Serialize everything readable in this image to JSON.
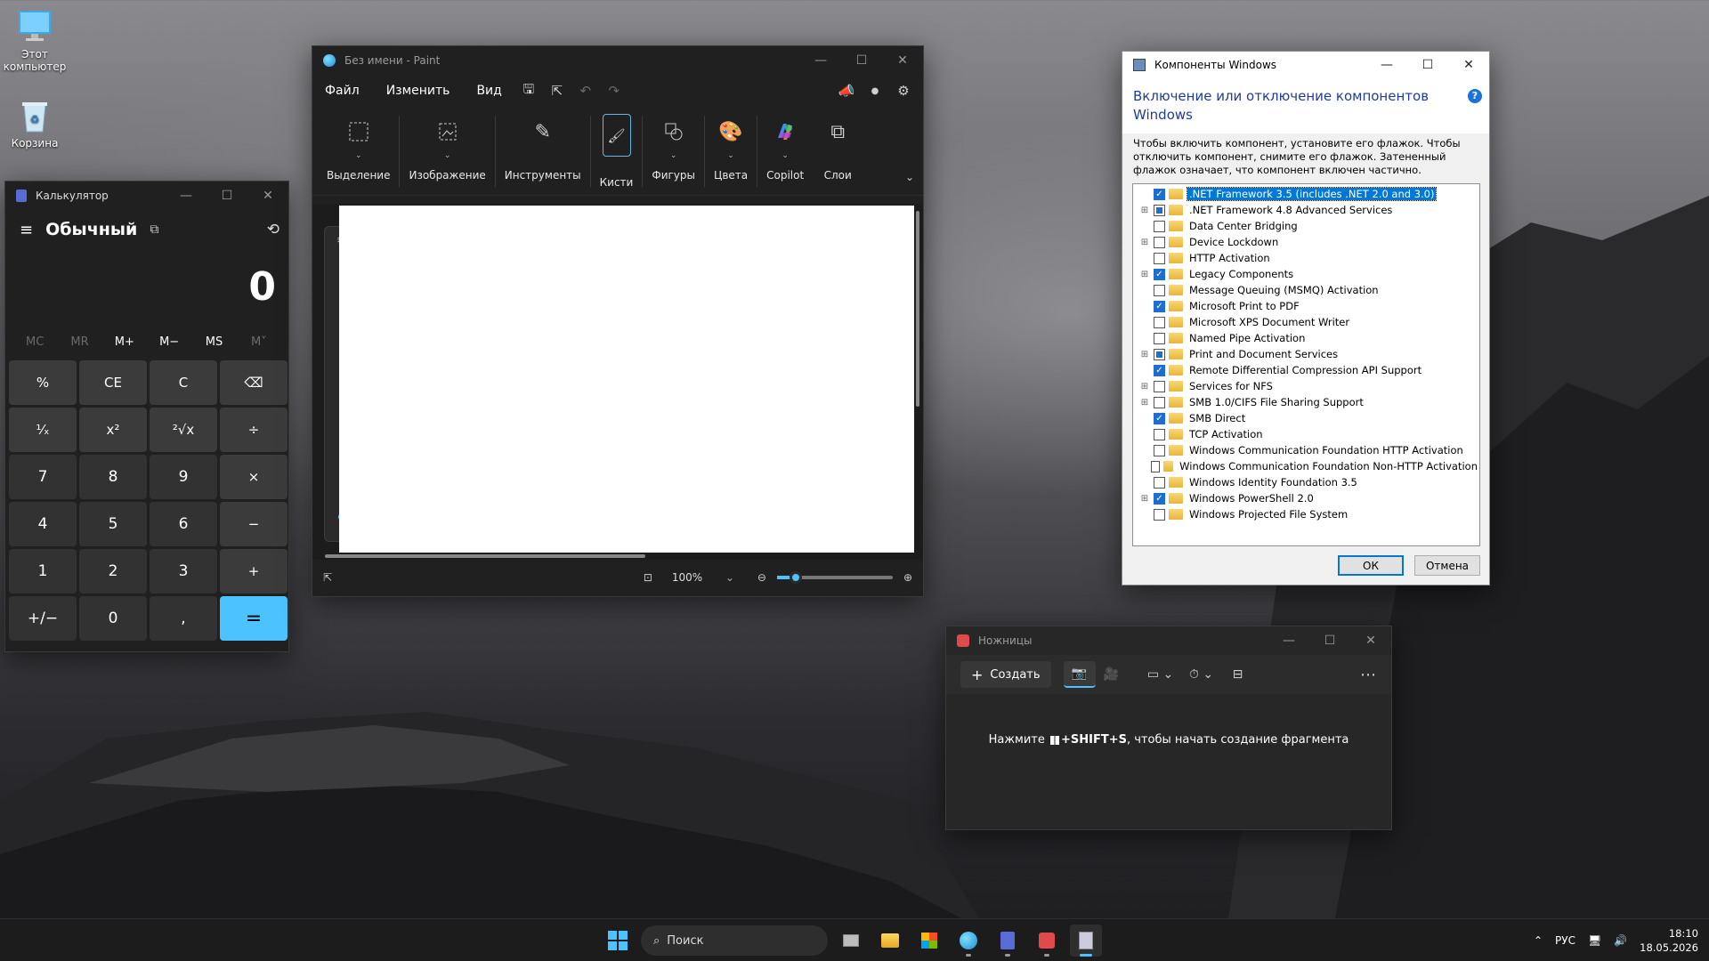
{
  "desktop": {
    "icons": [
      {
        "label": "Этот компьютер"
      },
      {
        "label": "Корзина"
      }
    ]
  },
  "calculator": {
    "title": "Калькулятор",
    "mode": "Обычный",
    "display": "0",
    "memory": [
      "MC",
      "MR",
      "M+",
      "M−",
      "MS",
      "M˅"
    ],
    "keys": [
      "%",
      "CE",
      "C",
      "⌫",
      "¹⁄ₓ",
      "x²",
      "²√x",
      "÷",
      "7",
      "8",
      "9",
      "×",
      "4",
      "5",
      "6",
      "−",
      "1",
      "2",
      "3",
      "+",
      "+/−",
      "0",
      ",",
      "="
    ]
  },
  "paint": {
    "title": "Без имени - Paint",
    "menu": [
      "Файл",
      "Изменить",
      "Вид"
    ],
    "ribbon": [
      "Выделение",
      "Изображение",
      "Инструменты",
      "Кисти",
      "Фигуры",
      "Цвета",
      "Copilot",
      "Слои"
    ],
    "zoom": "100%"
  },
  "features": {
    "title": "Компоненты Windows",
    "heading": "Включение или отключение компонентов Windows",
    "description": "Чтобы включить компонент, установите его флажок. Чтобы отключить компонент, снимите его флажок. Затененный флажок означает, что компонент включен частично.",
    "items": [
      {
        "label": ".NET Framework 3.5 (includes .NET 2.0 and 3.0)",
        "state": "on",
        "expand": false,
        "selected": true
      },
      {
        "label": ".NET Framework 4.8 Advanced Services",
        "state": "part",
        "expand": true,
        "selected": false
      },
      {
        "label": "Data Center Bridging",
        "state": "off",
        "expand": false,
        "selected": false
      },
      {
        "label": "Device Lockdown",
        "state": "off",
        "expand": true,
        "selected": false
      },
      {
        "label": "HTTP Activation",
        "state": "off",
        "expand": false,
        "selected": false
      },
      {
        "label": "Legacy Components",
        "state": "on",
        "expand": true,
        "selected": false
      },
      {
        "label": "Message Queuing (MSMQ) Activation",
        "state": "off",
        "expand": false,
        "selected": false
      },
      {
        "label": "Microsoft Print to PDF",
        "state": "on",
        "expand": false,
        "selected": false
      },
      {
        "label": "Microsoft XPS Document Writer",
        "state": "off",
        "expand": false,
        "selected": false
      },
      {
        "label": "Named Pipe Activation",
        "state": "off",
        "expand": false,
        "selected": false
      },
      {
        "label": "Print and Document Services",
        "state": "part",
        "expand": true,
        "selected": false
      },
      {
        "label": "Remote Differential Compression API Support",
        "state": "on",
        "expand": false,
        "selected": false
      },
      {
        "label": "Services for NFS",
        "state": "off",
        "expand": true,
        "selected": false
      },
      {
        "label": "SMB 1.0/CIFS File Sharing Support",
        "state": "off",
        "expand": true,
        "selected": false
      },
      {
        "label": "SMB Direct",
        "state": "on",
        "expand": false,
        "selected": false
      },
      {
        "label": "TCP Activation",
        "state": "off",
        "expand": false,
        "selected": false
      },
      {
        "label": "Windows Communication Foundation HTTP Activation",
        "state": "off",
        "expand": false,
        "selected": false
      },
      {
        "label": "Windows Communication Foundation Non-HTTP Activation",
        "state": "off",
        "expand": false,
        "selected": false
      },
      {
        "label": "Windows Identity Foundation 3.5",
        "state": "off",
        "expand": false,
        "selected": false
      },
      {
        "label": "Windows PowerShell 2.0",
        "state": "on",
        "expand": true,
        "selected": false
      },
      {
        "label": "Windows Projected File System",
        "state": "off",
        "expand": false,
        "selected": false
      }
    ],
    "ok_label": "ОК",
    "cancel_label": "Отмена"
  },
  "snipping": {
    "title": "Ножницы",
    "create_label": "Создать",
    "message_prefix": "Нажмите",
    "message_keys": "+SHIFT+S",
    "message_suffix": ", чтобы начать создание фрагмента"
  },
  "taskbar": {
    "search_placeholder": "Поиск",
    "lang": "РУС",
    "time": "18:10",
    "date": "18.05.2026"
  }
}
